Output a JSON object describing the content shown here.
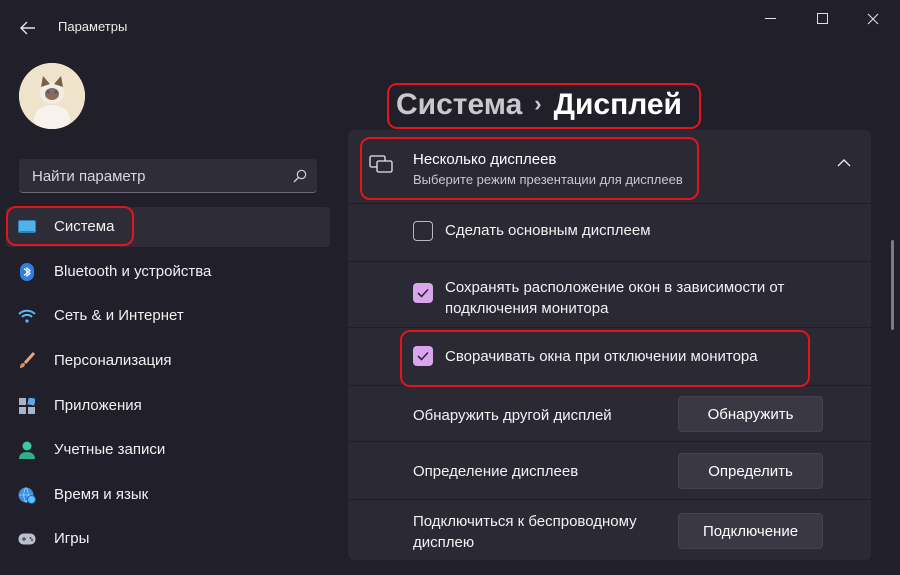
{
  "titlebar": {
    "title": "Параметры"
  },
  "search": {
    "placeholder": "Найти параметр"
  },
  "sidebar": {
    "items": [
      {
        "label": "Система",
        "icon": "monitor-icon",
        "active": true
      },
      {
        "label": "Bluetooth и устройства",
        "icon": "bluetooth-icon"
      },
      {
        "label": "Сеть & и Интернет",
        "icon": "wifi-icon"
      },
      {
        "label": "Персонализация",
        "icon": "brush-icon"
      },
      {
        "label": "Приложения",
        "icon": "apps-icon"
      },
      {
        "label": "Учетные записи",
        "icon": "account-icon"
      },
      {
        "label": "Время и язык",
        "icon": "globe-clock-icon"
      },
      {
        "label": "Игры",
        "icon": "gamepad-icon"
      }
    ]
  },
  "breadcrumb": {
    "parent": "Система",
    "separator": "›",
    "current": "Дисплей"
  },
  "section": {
    "title": "Несколько дисплеев",
    "subtitle": "Выберите режим презентации для дисплеев"
  },
  "options": [
    {
      "label": "Сделать основным дисплеем",
      "checked": false
    },
    {
      "label": "Сохранять расположение окон в зависимости от подключения монитора",
      "checked": true
    },
    {
      "label": "Сворачивать окна при отключении монитора",
      "checked": true
    }
  ],
  "actions": [
    {
      "label": "Обнаружить другой дисплей",
      "button": "Обнаружить"
    },
    {
      "label": "Определение дисплеев",
      "button": "Определить"
    },
    {
      "label": "Подключиться к беспроводному дисплею",
      "button": "Подключение"
    }
  ],
  "colors": {
    "accent": "#d9a6ee",
    "highlight": "#e3141b",
    "background": "#211f29",
    "card": "#2b2934"
  }
}
